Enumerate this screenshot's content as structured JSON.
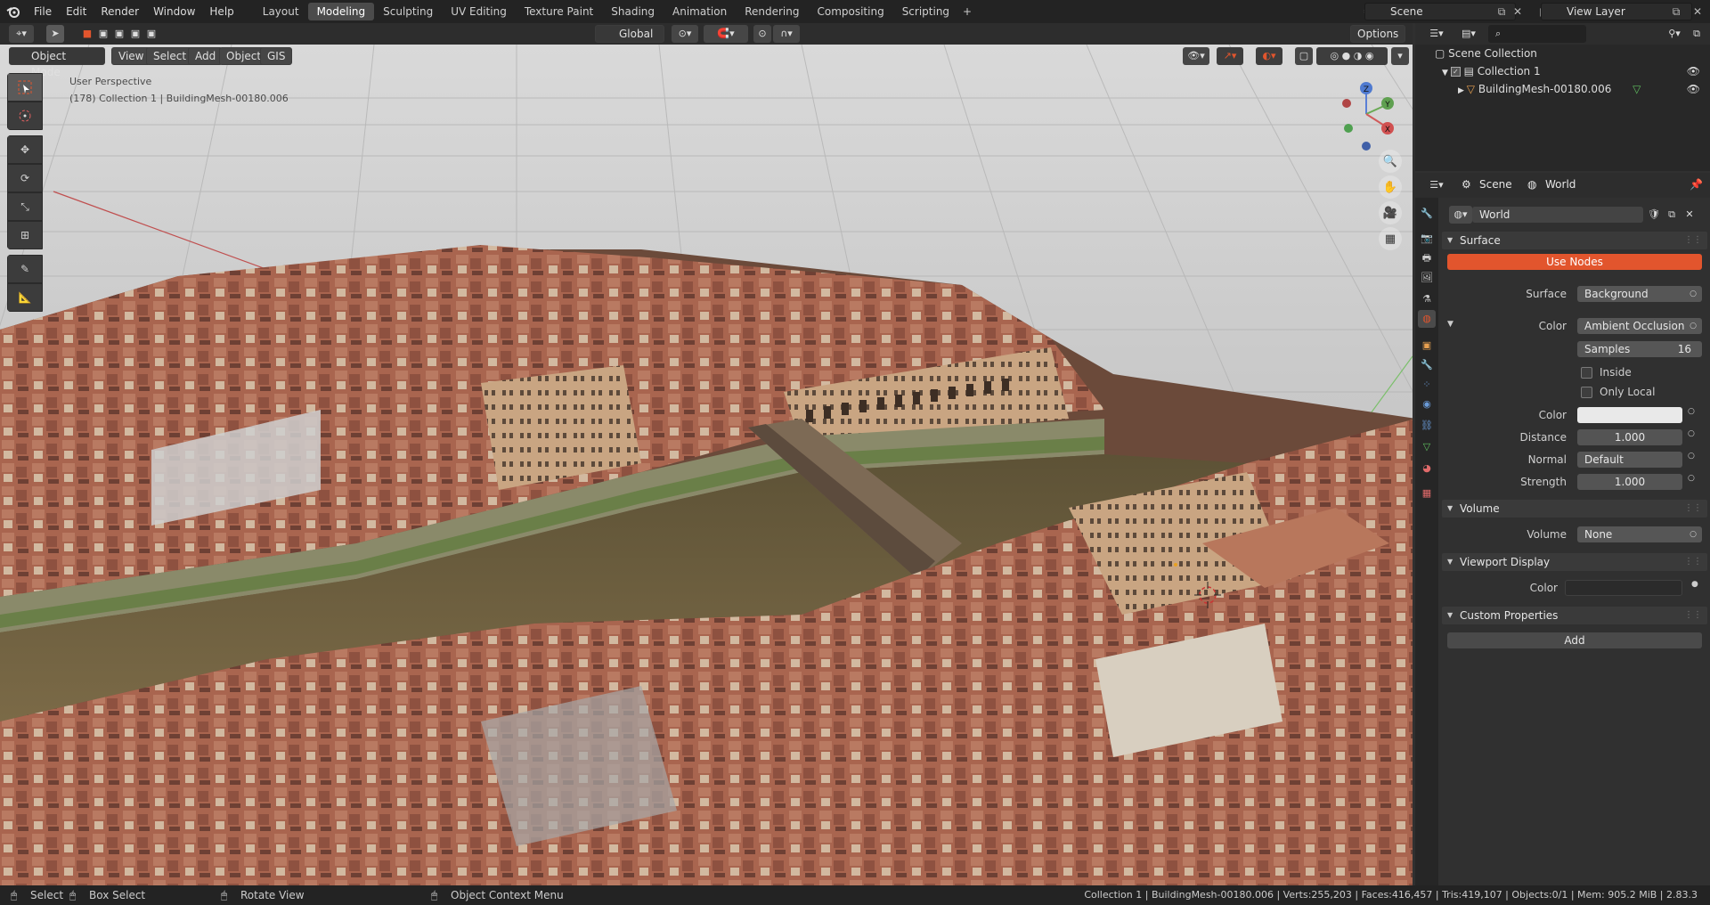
{
  "menubar": {
    "file": "File",
    "edit": "Edit",
    "render": "Render",
    "window": "Window",
    "help": "Help"
  },
  "workspaces": [
    "Layout",
    "Modeling",
    "Sculpting",
    "UV Editing",
    "Texture Paint",
    "Shading",
    "Animation",
    "Rendering",
    "Compositing",
    "Scripting"
  ],
  "active_workspace": "Modeling",
  "scene_field": "Scene",
  "view_layer_field": "View Layer",
  "header": {
    "mode": "Object Mode",
    "view": "View",
    "select": "Select",
    "add": "Add",
    "object": "Object",
    "gis": "GIS",
    "transform_orientation": "Global",
    "options": "Options"
  },
  "viewport": {
    "perspective": "User Perspective",
    "info": "(178) Collection 1 | BuildingMesh-00180.006",
    "gizmo": {
      "x": "X",
      "y": "Y",
      "z": "Z"
    }
  },
  "outliner": {
    "root": "Scene Collection",
    "collection": "Collection 1",
    "object": "BuildingMesh-00180.006"
  },
  "properties": {
    "breadcrumb_scene": "Scene",
    "breadcrumb_world": "World",
    "world_name": "World",
    "surface_panel": "Surface",
    "use_nodes": "Use Nodes",
    "surface_label": "Surface",
    "surface_value": "Background",
    "color_label": "Color",
    "color_value": "Ambient Occlusion",
    "samples_label": "Samples",
    "samples_value": "16",
    "inside_label": "Inside",
    "only_local_label": "Only Local",
    "color2_label": "Color",
    "distance_label": "Distance",
    "distance_value": "1.000",
    "normal_label": "Normal",
    "normal_value": "Default",
    "strength_label": "Strength",
    "strength_value": "1.000",
    "volume_panel": "Volume",
    "volume_label": "Volume",
    "volume_value": "None",
    "viewport_display_panel": "Viewport Display",
    "vd_color_label": "Color",
    "custom_props_panel": "Custom Properties",
    "add_button": "Add"
  },
  "colors": {
    "accent_orange": "#e2552d",
    "active_tab": "#4b4b4b"
  },
  "statusbar": {
    "select": "Select",
    "box_select": "Box Select",
    "rotate_view": "Rotate View",
    "context_menu": "Object Context Menu",
    "stats": "Collection 1 | BuildingMesh-00180.006 | Verts:255,203 | Faces:416,457 | Tris:419,107 | Objects:0/1 | Mem: 905.2 MiB | 2.83.3"
  }
}
